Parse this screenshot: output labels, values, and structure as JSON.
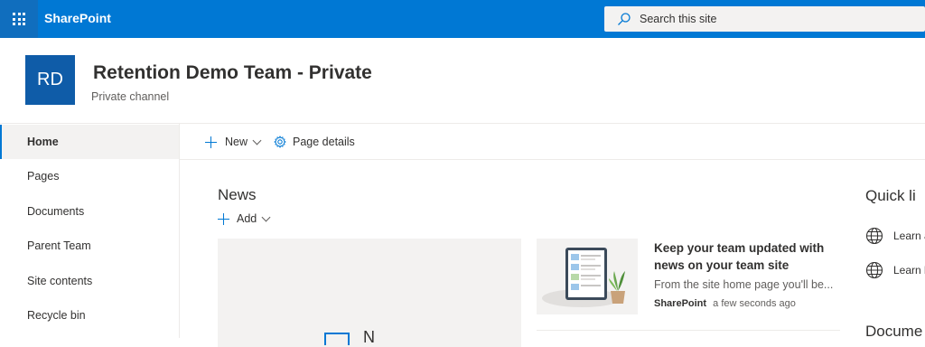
{
  "suite": {
    "brand": "SharePoint"
  },
  "search": {
    "placeholder": "Search this site"
  },
  "site": {
    "logo_initials": "RD",
    "title": "Retention Demo Team - Private",
    "subtitle": "Private channel"
  },
  "nav": {
    "items": [
      {
        "label": "Home",
        "selected": true
      },
      {
        "label": "Pages"
      },
      {
        "label": "Documents"
      },
      {
        "label": "Parent Team"
      },
      {
        "label": "Site contents"
      },
      {
        "label": "Recycle bin"
      }
    ]
  },
  "commandbar": {
    "new_label": "New",
    "page_details_label": "Page details"
  },
  "news": {
    "title": "News",
    "add_label": "Add",
    "hero_placeholder": "N",
    "card": {
      "headline": "Keep your team updated with news on your team site",
      "description": "From the site home page you'll be...",
      "author": "SharePoint",
      "time": "a few seconds ago"
    }
  },
  "quick_links": {
    "title": "Quick li",
    "items": [
      {
        "label": "Learn a"
      },
      {
        "label": "Learn l"
      }
    ]
  },
  "documents": {
    "title": "Docume"
  },
  "colors": {
    "suitebar": "#0078d4",
    "waffle": "#106ebe",
    "logo": "#0f5ca8",
    "accent": "#0078d4"
  }
}
